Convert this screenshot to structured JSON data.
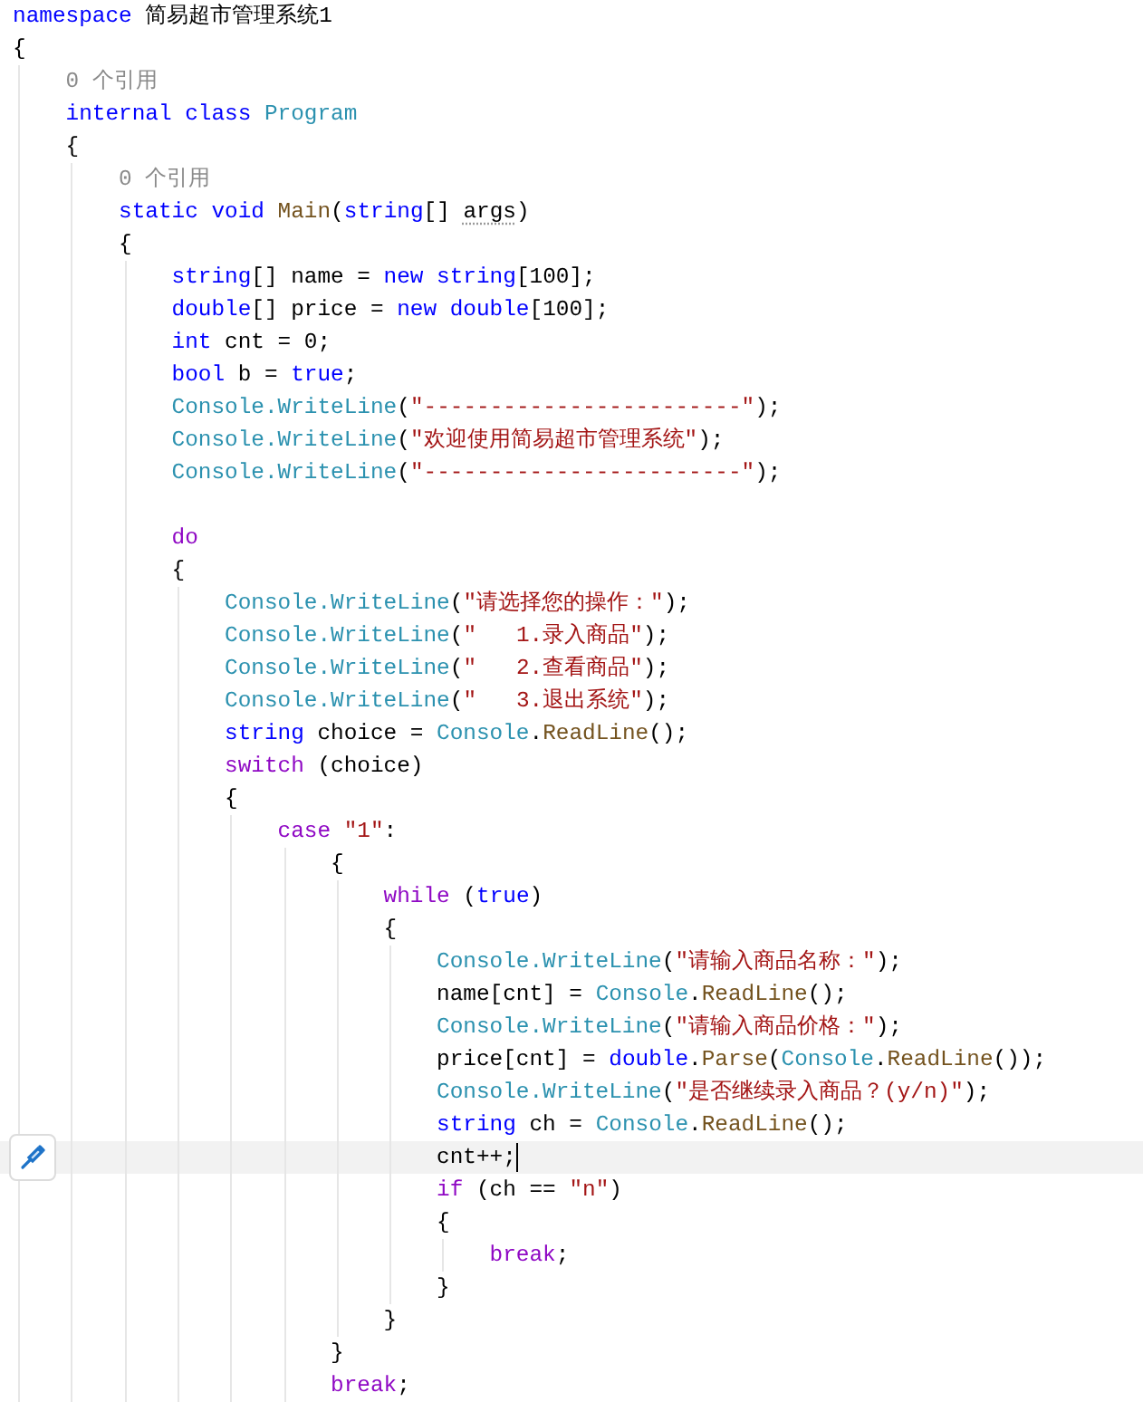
{
  "editor": {
    "lines": [
      {
        "current": false,
        "tokens": [
          {
            "kind": "keyword",
            "text": "namespace"
          },
          {
            "kind": "plain",
            "text": " 简易超市管理系统1"
          }
        ]
      },
      {
        "current": false,
        "tokens": [
          {
            "kind": "plain",
            "text": "{"
          }
        ]
      },
      {
        "current": false,
        "tokens": [
          {
            "kind": "lens",
            "text": "    0 个引用"
          }
        ]
      },
      {
        "current": false,
        "tokens": [
          {
            "kind": "keyword",
            "text": "    internal class "
          },
          {
            "kind": "type",
            "text": "Program"
          }
        ]
      },
      {
        "current": false,
        "tokens": [
          {
            "kind": "plain",
            "text": "    {"
          }
        ]
      },
      {
        "current": false,
        "tokens": [
          {
            "kind": "lens",
            "text": "        0 个引用"
          }
        ]
      },
      {
        "current": false,
        "tokens": [
          {
            "kind": "keyword",
            "text": "        static void "
          },
          {
            "kind": "method",
            "text": "Main"
          },
          {
            "kind": "plain",
            "text": "("
          },
          {
            "kind": "keyword",
            "text": "string"
          },
          {
            "kind": "plain",
            "text": "[] "
          },
          {
            "kind": "unused",
            "text": "args"
          },
          {
            "kind": "plain",
            "text": ")"
          }
        ]
      },
      {
        "current": false,
        "tokens": [
          {
            "kind": "plain",
            "text": "        {"
          }
        ]
      },
      {
        "current": false,
        "tokens": [
          {
            "kind": "keyword",
            "text": "            string"
          },
          {
            "kind": "plain",
            "text": "[] name = "
          },
          {
            "kind": "keyword",
            "text": "new string"
          },
          {
            "kind": "plain",
            "text": "[100];"
          }
        ]
      },
      {
        "current": false,
        "tokens": [
          {
            "kind": "keyword",
            "text": "            double"
          },
          {
            "kind": "plain",
            "text": "[] price = "
          },
          {
            "kind": "keyword",
            "text": "new double"
          },
          {
            "kind": "plain",
            "text": "[100];"
          }
        ]
      },
      {
        "current": false,
        "tokens": [
          {
            "kind": "keyword",
            "text": "            int"
          },
          {
            "kind": "plain",
            "text": " cnt = 0;"
          }
        ]
      },
      {
        "current": false,
        "tokens": [
          {
            "kind": "keyword",
            "text": "            bool"
          },
          {
            "kind": "plain",
            "text": " b = "
          },
          {
            "kind": "keyword",
            "text": "true"
          },
          {
            "kind": "plain",
            "text": ";"
          }
        ]
      },
      {
        "current": false,
        "tokens": [
          {
            "kind": "type",
            "text": "            Console.WriteLine"
          },
          {
            "kind": "plain",
            "text": "("
          },
          {
            "kind": "string",
            "text": "\"------------------------\""
          },
          {
            "kind": "plain",
            "text": ");"
          }
        ]
      },
      {
        "current": false,
        "tokens": [
          {
            "kind": "type",
            "text": "            Console.WriteLine"
          },
          {
            "kind": "plain",
            "text": "("
          },
          {
            "kind": "string",
            "text": "\"欢迎使用简易超市管理系统\""
          },
          {
            "kind": "plain",
            "text": ");"
          }
        ]
      },
      {
        "current": false,
        "tokens": [
          {
            "kind": "type",
            "text": "            Console.WriteLine"
          },
          {
            "kind": "plain",
            "text": "("
          },
          {
            "kind": "string",
            "text": "\"------------------------\""
          },
          {
            "kind": "plain",
            "text": ");"
          }
        ]
      },
      {
        "current": false
      },
      {
        "current": false,
        "tokens": [
          {
            "kind": "control",
            "text": "            do"
          }
        ]
      },
      {
        "current": false,
        "tokens": [
          {
            "kind": "plain",
            "text": "            {"
          }
        ]
      },
      {
        "current": false,
        "tokens": [
          {
            "kind": "type",
            "text": "                Console.WriteLine"
          },
          {
            "kind": "plain",
            "text": "("
          },
          {
            "kind": "string",
            "text": "\"请选择您的操作：\""
          },
          {
            "kind": "plain",
            "text": ");"
          }
        ]
      },
      {
        "current": false,
        "tokens": [
          {
            "kind": "type",
            "text": "                Console.WriteLine"
          },
          {
            "kind": "plain",
            "text": "("
          },
          {
            "kind": "string",
            "text": "\"   1.录入商品\""
          },
          {
            "kind": "plain",
            "text": ");"
          }
        ]
      },
      {
        "current": false,
        "tokens": [
          {
            "kind": "type",
            "text": "                Console.WriteLine"
          },
          {
            "kind": "plain",
            "text": "("
          },
          {
            "kind": "string",
            "text": "\"   2.查看商品\""
          },
          {
            "kind": "plain",
            "text": ");"
          }
        ]
      },
      {
        "current": false,
        "tokens": [
          {
            "kind": "type",
            "text": "                Console.WriteLine"
          },
          {
            "kind": "plain",
            "text": "("
          },
          {
            "kind": "string",
            "text": "\"   3.退出系统\""
          },
          {
            "kind": "plain",
            "text": ");"
          }
        ]
      },
      {
        "current": false,
        "tokens": [
          {
            "kind": "keyword",
            "text": "                string"
          },
          {
            "kind": "plain",
            "text": " choice = "
          },
          {
            "kind": "type",
            "text": "Console"
          },
          {
            "kind": "plain",
            "text": "."
          },
          {
            "kind": "method",
            "text": "ReadLine"
          },
          {
            "kind": "plain",
            "text": "();"
          }
        ]
      },
      {
        "current": false,
        "tokens": [
          {
            "kind": "control",
            "text": "                switch"
          },
          {
            "kind": "plain",
            "text": " (choice)"
          }
        ]
      },
      {
        "current": false,
        "tokens": [
          {
            "kind": "plain",
            "text": "                {"
          }
        ]
      },
      {
        "current": false,
        "tokens": [
          {
            "kind": "control",
            "text": "                    case "
          },
          {
            "kind": "string",
            "text": "\"1\""
          },
          {
            "kind": "plain",
            "text": ":"
          }
        ]
      },
      {
        "current": false,
        "tokens": [
          {
            "kind": "plain",
            "text": "                        {"
          }
        ]
      },
      {
        "current": false,
        "tokens": [
          {
            "kind": "control",
            "text": "                            while"
          },
          {
            "kind": "plain",
            "text": " ("
          },
          {
            "kind": "keyword",
            "text": "true"
          },
          {
            "kind": "plain",
            "text": ")"
          }
        ]
      },
      {
        "current": false,
        "tokens": [
          {
            "kind": "plain",
            "text": "                            {"
          }
        ]
      },
      {
        "current": false,
        "tokens": [
          {
            "kind": "type",
            "text": "                                Console.WriteLine"
          },
          {
            "kind": "plain",
            "text": "("
          },
          {
            "kind": "string",
            "text": "\"请输入商品名称：\""
          },
          {
            "kind": "plain",
            "text": ");"
          }
        ]
      },
      {
        "current": false,
        "tokens": [
          {
            "kind": "plain",
            "text": "                                name[cnt] = "
          },
          {
            "kind": "type",
            "text": "Console"
          },
          {
            "kind": "plain",
            "text": "."
          },
          {
            "kind": "method",
            "text": "ReadLine"
          },
          {
            "kind": "plain",
            "text": "();"
          }
        ]
      },
      {
        "current": false,
        "tokens": [
          {
            "kind": "type",
            "text": "                                Console.WriteLine"
          },
          {
            "kind": "plain",
            "text": "("
          },
          {
            "kind": "string",
            "text": "\"请输入商品价格：\""
          },
          {
            "kind": "plain",
            "text": ");"
          }
        ]
      },
      {
        "current": false,
        "tokens": [
          {
            "kind": "plain",
            "text": "                                price[cnt] = "
          },
          {
            "kind": "keyword",
            "text": "double"
          },
          {
            "kind": "plain",
            "text": "."
          },
          {
            "kind": "method",
            "text": "Parse"
          },
          {
            "kind": "plain",
            "text": "("
          },
          {
            "kind": "type",
            "text": "Console"
          },
          {
            "kind": "plain",
            "text": "."
          },
          {
            "kind": "method",
            "text": "ReadLine"
          },
          {
            "kind": "plain",
            "text": "());"
          }
        ]
      },
      {
        "current": false,
        "tokens": [
          {
            "kind": "type",
            "text": "                                Console.WriteLine"
          },
          {
            "kind": "plain",
            "text": "("
          },
          {
            "kind": "string",
            "text": "\"是否继续录入商品？(y/n)\""
          },
          {
            "kind": "plain",
            "text": ");"
          }
        ]
      },
      {
        "current": false,
        "tokens": [
          {
            "kind": "keyword",
            "text": "                                string"
          },
          {
            "kind": "plain",
            "text": " ch = "
          },
          {
            "kind": "type",
            "text": "Console"
          },
          {
            "kind": "plain",
            "text": "."
          },
          {
            "kind": "method",
            "text": "ReadLine"
          },
          {
            "kind": "plain",
            "text": "();"
          }
        ]
      },
      {
        "current": true,
        "tokens": [
          {
            "kind": "plain",
            "text": "                                cnt++;"
          }
        ]
      },
      {
        "current": false,
        "tokens": [
          {
            "kind": "control",
            "text": "                                if"
          },
          {
            "kind": "plain",
            "text": " (ch == "
          },
          {
            "kind": "string",
            "text": "\"n\""
          },
          {
            "kind": "plain",
            "text": ")"
          }
        ]
      },
      {
        "current": false,
        "tokens": [
          {
            "kind": "plain",
            "text": "                                {"
          }
        ]
      },
      {
        "current": false,
        "tokens": [
          {
            "kind": "control",
            "text": "                                    break"
          },
          {
            "kind": "plain",
            "text": ";"
          }
        ]
      },
      {
        "current": false,
        "tokens": [
          {
            "kind": "plain",
            "text": "                                }"
          }
        ]
      },
      {
        "current": false,
        "tokens": [
          {
            "kind": "plain",
            "text": "                            }"
          }
        ]
      },
      {
        "current": false,
        "tokens": [
          {
            "kind": "plain",
            "text": "                        }"
          }
        ]
      },
      {
        "current": false,
        "tokens": [
          {
            "kind": "control",
            "text": "                        break"
          },
          {
            "kind": "plain",
            "text": ";"
          }
        ]
      }
    ]
  }
}
